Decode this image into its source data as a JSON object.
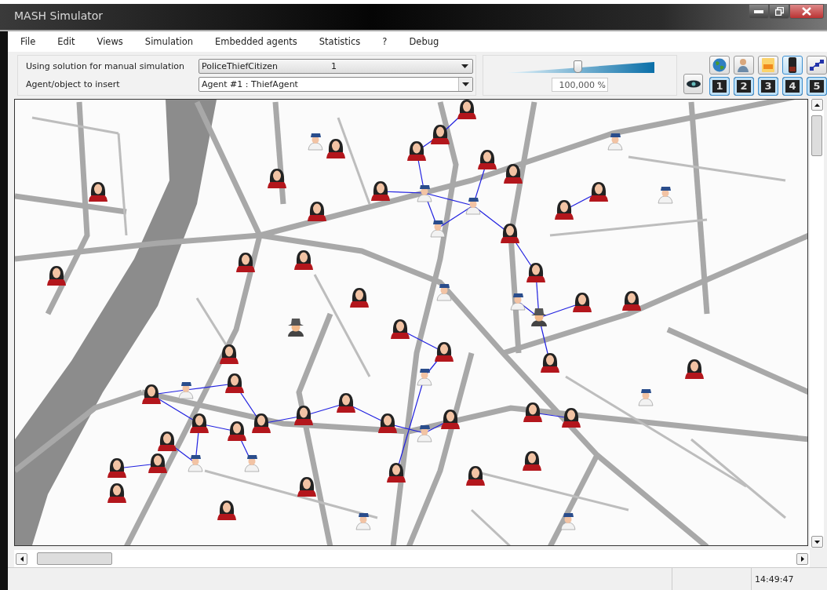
{
  "window": {
    "title": "MASH Simulator"
  },
  "menu": [
    "File",
    "Edit",
    "Views",
    "Simulation",
    "Embedded agents",
    "Statistics",
    "?",
    "Debug"
  ],
  "toolbar": {
    "solution_label": "Using solution for manual simulation",
    "solution_value": "PoliceThiefCitizen",
    "solution_index": "1",
    "insert_label": "Agent/object to insert",
    "insert_value": "Agent #1 : ThiefAgent",
    "speed_slider": {
      "level": 0.49
    },
    "speed_value": "100,000 %",
    "tool_buttons": [
      {
        "pressed": false
      },
      {
        "pressed": false
      },
      {
        "pressed": false
      },
      {
        "pressed": true
      },
      {
        "pressed": false
      }
    ],
    "number_buttons": [
      {
        "label": "1",
        "pressed": true
      },
      {
        "label": "2",
        "pressed": true
      },
      {
        "label": "3",
        "pressed": true
      },
      {
        "label": "4",
        "pressed": true
      },
      {
        "label": "5",
        "pressed": true
      }
    ]
  },
  "status_bar": {
    "time": "14:49:47"
  }
}
